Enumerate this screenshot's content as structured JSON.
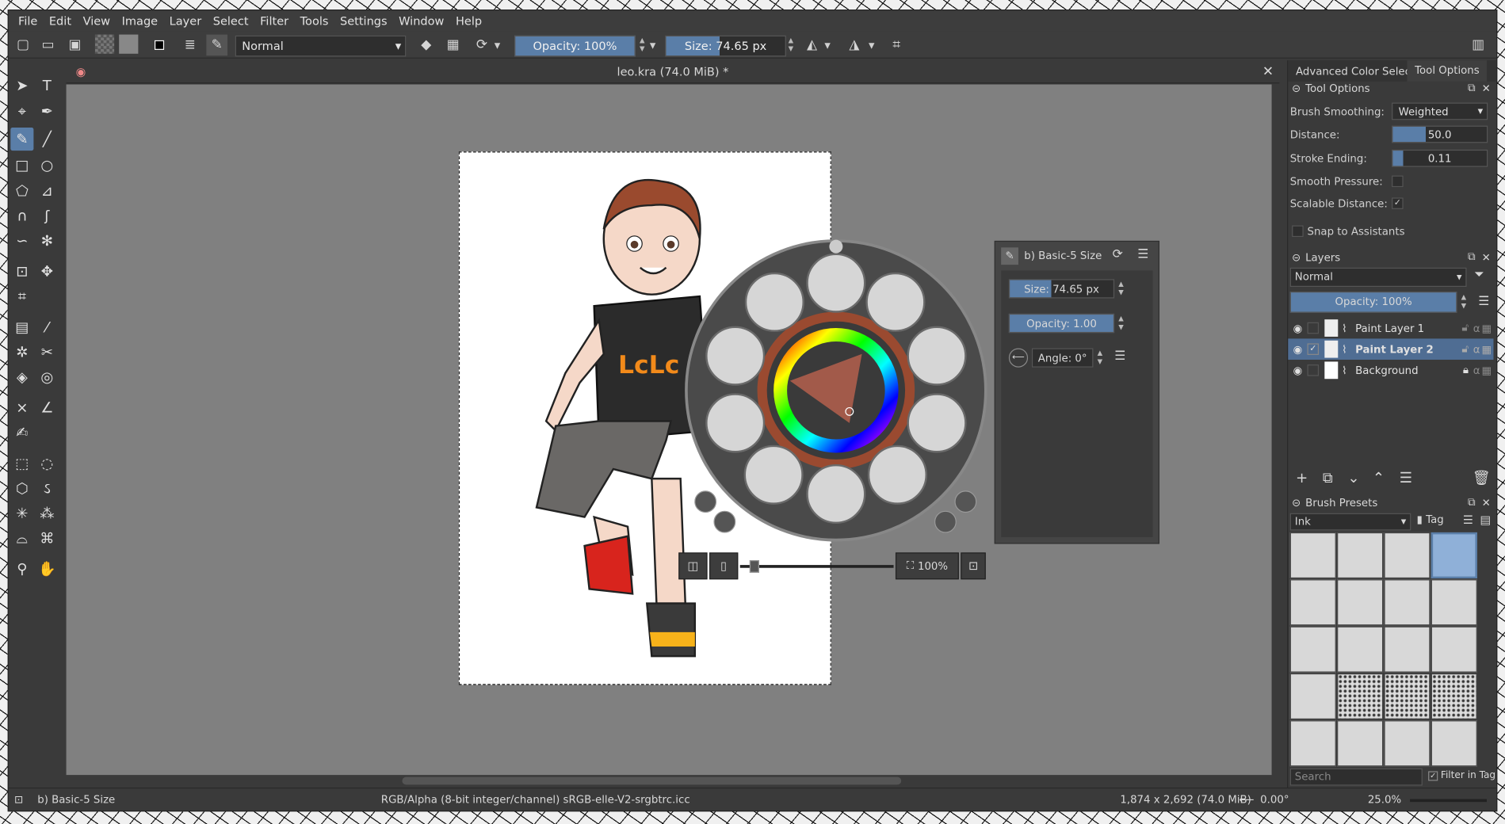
{
  "menu": [
    "File",
    "Edit",
    "View",
    "Image",
    "Layer",
    "Select",
    "Filter",
    "Tools",
    "Settings",
    "Window",
    "Help"
  ],
  "toolbar": {
    "blend_mode": "Normal",
    "opacity": "Opacity: 100%",
    "size": "Size: 74.65 px"
  },
  "document": {
    "title": "leo.kra (74.0 MiB) *"
  },
  "canvas_popup": {
    "zoom": "100%"
  },
  "brush_editor": {
    "title": "b) Basic-5 Size",
    "size": "Size: 74.65 px",
    "opacity": "Opacity: 1.00",
    "angle": "Angle: 0°"
  },
  "dock": {
    "tabs": [
      "Advanced Color Selector",
      "Tool Options"
    ],
    "tool_options": {
      "title": "Tool Options",
      "brush_smoothing_label": "Brush Smoothing:",
      "brush_smoothing": "Weighted",
      "distance_label": "Distance:",
      "distance": "50.0",
      "stroke_ending_label": "Stroke Ending:",
      "stroke_ending": "0.11",
      "smooth_pressure_label": "Smooth Pressure:",
      "scalable_distance_label": "Scalable Distance:",
      "snap_label": "Snap to Assistants"
    },
    "layers": {
      "title": "Layers",
      "blend": "Normal",
      "opacity": "Opacity:  100%",
      "items": [
        "Paint Layer 1",
        "Paint Layer 2",
        "Background"
      ]
    },
    "presets": {
      "title": "Brush Presets",
      "tag_filter": "Ink",
      "tag": "Tag",
      "search_placeholder": "Search",
      "filter_in_tag": "Filter in Tag"
    }
  },
  "status": {
    "brush": "b) Basic-5 Size",
    "color_space": "RGB/Alpha (8-bit integer/channel)  sRGB-elle-V2-srgbtrc.icc",
    "dimensions": "1,874 x 2,692 (74.0 MiB)",
    "rotation": "0.00°",
    "zoom": "25.0%"
  },
  "colors": {
    "accent": "#5a7ea8",
    "panel": "#3a3a3a",
    "canvas": "#808080"
  }
}
